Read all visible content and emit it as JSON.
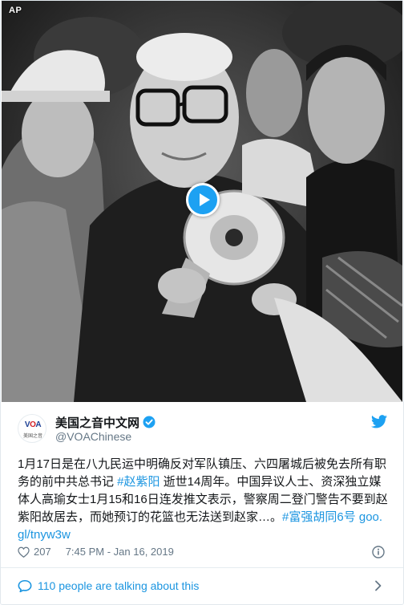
{
  "media": {
    "source_tag": "AP",
    "play_button_icon": "play-icon"
  },
  "account": {
    "display_name": "美国之音中文网",
    "handle": "@VOAChinese",
    "avatar_text": "VOA",
    "avatar_subtext": "美国之音",
    "verified_icon": "verified-badge-icon",
    "platform_icon": "twitter-bird-icon"
  },
  "tweet": {
    "text_1": "1月17日是在八九民运中明确反对军队镇压、六四屠城后被免去所有职务的前中共总书记 ",
    "hashtag_1": "#赵紫阳",
    "text_2": " 逝世14周年。中国异议人士、资深独立媒体人高瑜女士1月15和16日连发推文表示，警察周二登门警告不要到赵紫阳故居去，而她预订的花篮也无法送到赵家…。",
    "hashtag_2": "#富强胡同6号",
    "link": "goo.gl/tnyw3w"
  },
  "meta": {
    "likes": "207",
    "timestamp": "7:45 PM - Jan 16, 2019",
    "heart_icon": "heart-icon",
    "info_icon": "info-icon"
  },
  "conversation": {
    "label": "110 people are talking about this",
    "icon": "speech-bubble-icon",
    "chevron": "chevron-right-icon"
  },
  "colors": {
    "link": "#1b95e0",
    "twitter_blue": "#1da1f2",
    "text": "#14171a",
    "muted": "#657786"
  }
}
